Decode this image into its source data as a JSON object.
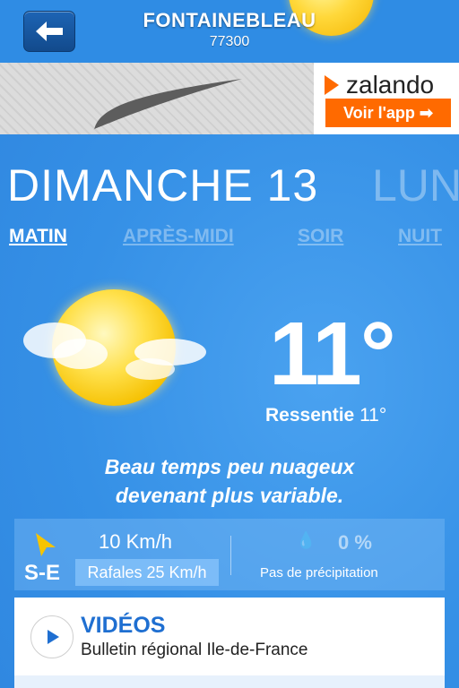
{
  "header": {
    "city": "FONTAINEBLEAU",
    "zip": "77300",
    "back_icon": "arrow-left-icon"
  },
  "ad": {
    "brand": "zalando",
    "cta": "Voir l'app ➡",
    "brand_color": "#ff6a00"
  },
  "day": {
    "current": "DIMANCHE 13",
    "next": "LUN"
  },
  "periods": [
    "MATIN",
    "APRÈS-MIDI",
    "SOIR",
    "NUIT"
  ],
  "weather": {
    "temperature": "11°",
    "feels_label": "Ressentie",
    "feels_value": "11°",
    "description_line1": "Beau temps peu nuageux",
    "description_line2": "devenant plus variable."
  },
  "wind": {
    "speed": "10 Km/h",
    "direction": "S-E",
    "gusts": "Rafales 25 Km/h"
  },
  "precip": {
    "value": "0 %",
    "label": "Pas de précipitation"
  },
  "videos": {
    "title": "VIDÉOS",
    "subtitle": "Bulletin régional Ile-de-France"
  }
}
